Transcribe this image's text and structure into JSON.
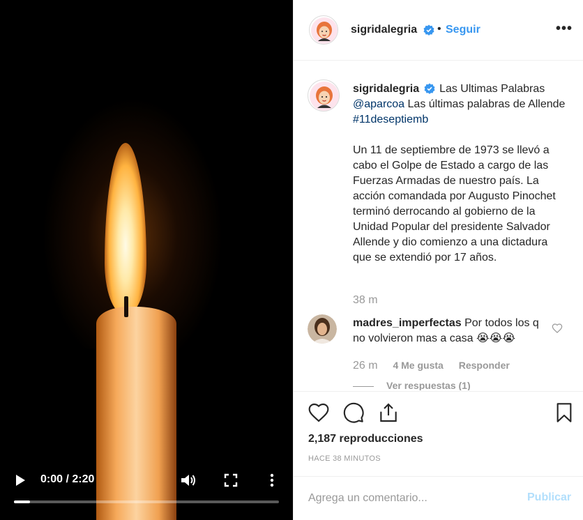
{
  "video": {
    "time": "0:00 / 2:20",
    "progress": 0.06,
    "icons": [
      "play-icon",
      "volume-icon",
      "fullscreen-icon",
      "more-vertical-icon"
    ]
  },
  "header": {
    "username": "sigridalegria",
    "dot": "•",
    "follow_label": "Seguir",
    "more_label": "•••"
  },
  "caption": {
    "username": "sigridalegria",
    "title": "Las Ultimas Palabras",
    "mention": "@aparcoa",
    "text": "Las últimas palabras de Allende",
    "hashtag": "#11deseptiemb",
    "body": "Un 11 de septiembre de 1973 se llevó a cabo el Golpe de Estado a cargo de las Fuerzas Armadas de nuestro país. La acción comandada por Augusto Pinochet terminó derrocando al gobierno de la Unidad Popular del presidente Salvador Allende y dio comienzo a una dictadura que se extendió por 17 años.",
    "time": "38 m"
  },
  "comment": {
    "username": "madres_imperfectas",
    "text": "Por todos los q no volvieron mas a casa 😭😭😭",
    "time": "26 m",
    "likes": "4 Me gusta",
    "reply_label": "Responder",
    "view_replies": "Ver respuestas (1)"
  },
  "post": {
    "views": "2,187 reproducciones",
    "timestamp": "HACE 38 MINUTOS"
  },
  "add_comment": {
    "placeholder": "Agrega un comentario...",
    "publish_label": "Publicar"
  },
  "colors": {
    "link": "#003569",
    "follow": "#3897f0",
    "muted": "#999999",
    "verified": "#3897f0",
    "publish_disabled": "#b2dffc"
  }
}
